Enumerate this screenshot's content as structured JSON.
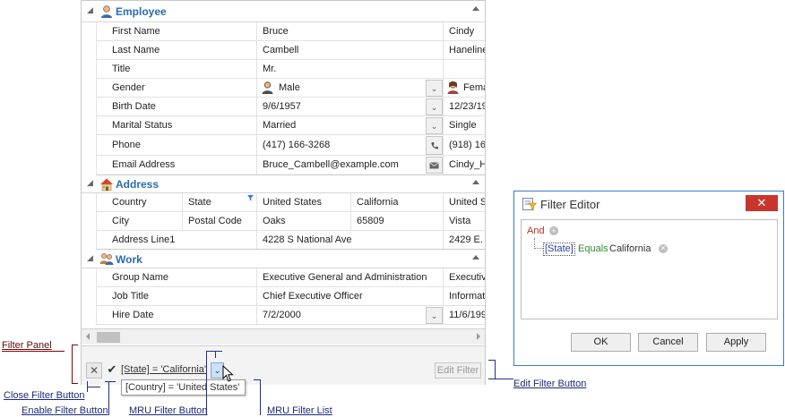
{
  "grid": {
    "categories": [
      {
        "title": "Employee",
        "icon": "person-icon"
      },
      {
        "title": "Address",
        "icon": "house-icon"
      },
      {
        "title": "Work",
        "icon": "people-icon"
      }
    ],
    "employee_rows": [
      {
        "label": "First Name",
        "v1": "Bruce",
        "v2": "Cindy"
      },
      {
        "label": "Last Name",
        "v1": "Cambell",
        "v2": "Haneline"
      },
      {
        "label": "Title",
        "v1": "Mr.",
        "v2": ""
      },
      {
        "label": "Gender",
        "v1": "Male",
        "v2": "Fema"
      },
      {
        "label": "Birth Date",
        "v1": "9/6/1957",
        "v2": "12/23/19"
      },
      {
        "label": "Marital Status",
        "v1": "Married",
        "v2": "Single"
      },
      {
        "label": "Phone",
        "v1": "(417) 166-3268",
        "v2": "(918) 16"
      },
      {
        "label": "Email Address",
        "v1": "Bruce_Cambell@example.com",
        "v2": "Cindy_Ha"
      }
    ],
    "address_rows": [
      {
        "label1": "Country",
        "label2": "State",
        "v1a": "United States",
        "v1b": "California",
        "v2": "United St"
      },
      {
        "label1": "City",
        "label2": "Postal Code",
        "v1a": "Oaks",
        "v1b": "65809",
        "v2": "Vista"
      },
      {
        "label": "Address Line1",
        "v1": "4228 S National Ave",
        "v2": "2429 E."
      }
    ],
    "work_rows": [
      {
        "label": "Group Name",
        "v1": "Executive General and Administration",
        "v2": "Executive"
      },
      {
        "label": "Job Title",
        "v1": "Chief Executive Officer",
        "v2": "Informati"
      },
      {
        "label": "Hire Date",
        "v1": "7/2/2000",
        "v2": "11/6/199"
      }
    ]
  },
  "filter_panel": {
    "filter_text": "[State] = 'California'",
    "edit_filter_label": "Edit Filter",
    "mru_item": "[Country] = 'United States'"
  },
  "callouts": {
    "filter_panel": "Filter Panel",
    "close_filter_button": "Close Filter Button",
    "enable_filter_button": "Enable Filter Button",
    "mru_filter_button": "MRU Filter Button",
    "mru_filter_list": "MRU Filter List",
    "edit_filter_button": "Edit Filter Button"
  },
  "filter_editor": {
    "title": "Filter Editor",
    "group_op": "And",
    "field": "[State]",
    "operator": "Equals",
    "value": "California",
    "ok_label": "OK",
    "cancel_label": "Cancel",
    "apply_label": "Apply"
  },
  "colors": {
    "category_title": "#2a6bb0",
    "callout_text": "#1d2a7a",
    "filter_panel_bracket": "#8b0000",
    "dialog_border": "#3a7cc4",
    "dialog_close": "#c7362d"
  }
}
